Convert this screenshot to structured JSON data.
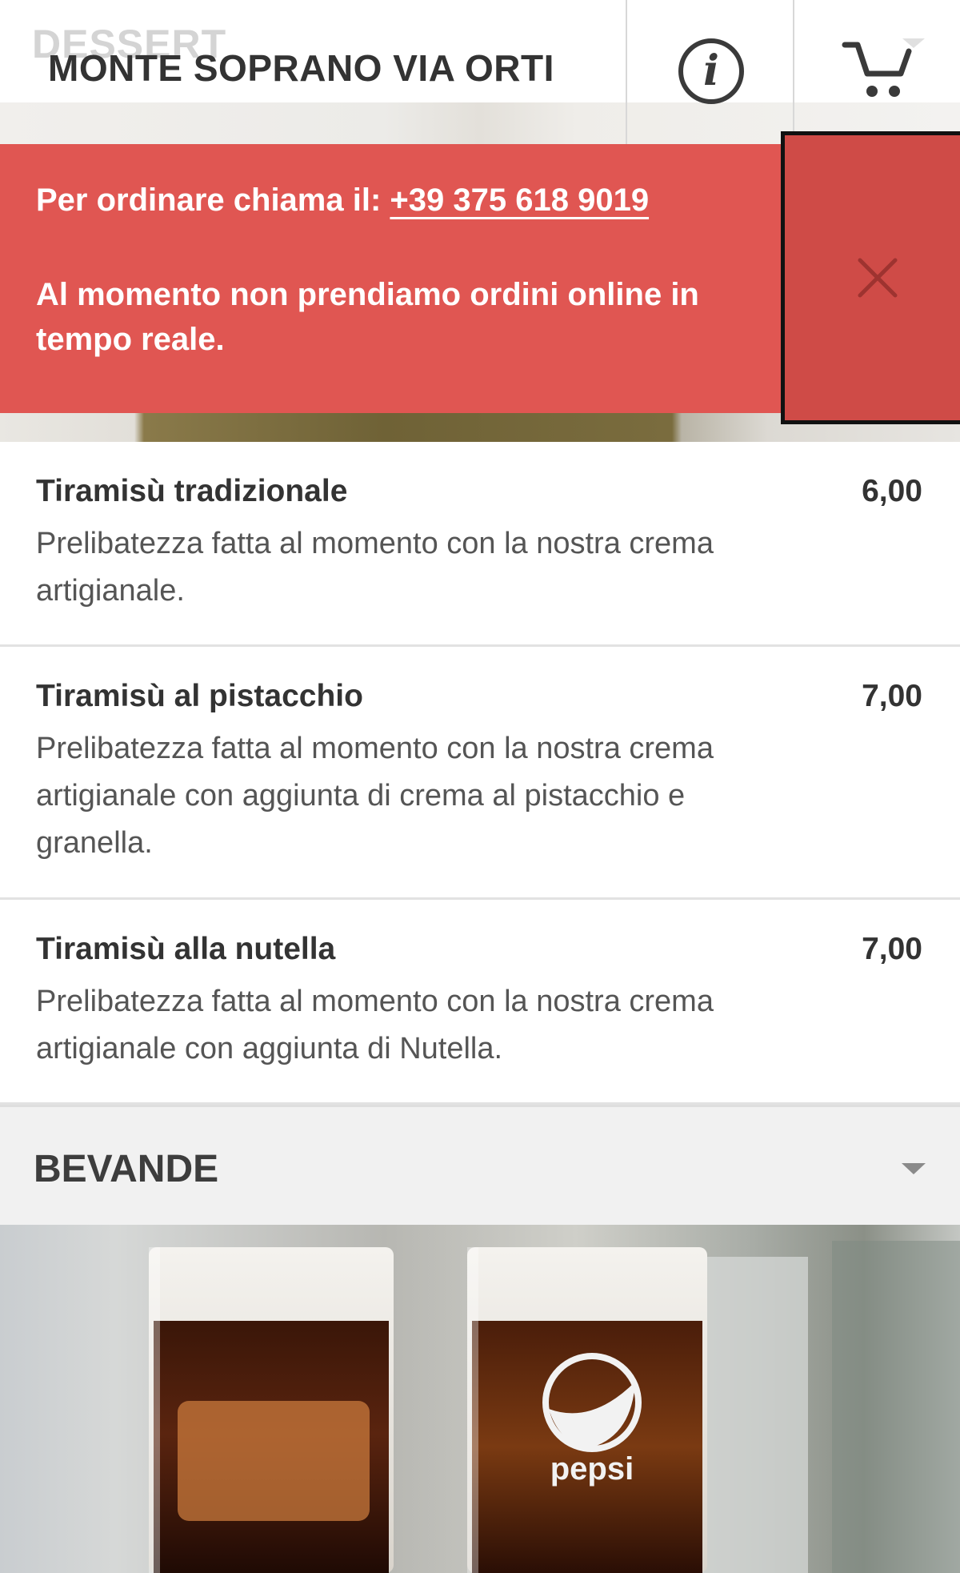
{
  "header": {
    "background_section_label": "DESSERT",
    "restaurant_name": "MONTE SOPRANO VIA ORTI",
    "info_icon": "info-icon",
    "cart_icon": "cart-icon"
  },
  "alert": {
    "order_prompt": "Per ordinare chiama il:",
    "phone": "+39 375 618 9019",
    "message": "Al momento non prendiamo ordini online in tempo reale.",
    "close_icon": "close-icon",
    "background_color": "#e05652"
  },
  "menu_items": [
    {
      "name": "Tiramisù tradizionale",
      "price": "6,00",
      "description": "Prelibatezza fatta al momento con la nostra crema artigianale."
    },
    {
      "name": "Tiramisù al pistacchio",
      "price": "7,00",
      "description": "Prelibatezza fatta al momento con la nostra crema artigianale con aggiunta di crema al pistacchio e granella."
    },
    {
      "name": "Tiramisù alla nutella",
      "price": "7,00",
      "description": "Prelibatezza fatta al momento con la nostra crema artigianale con aggiunta di Nutella."
    }
  ],
  "category": {
    "title": "BEVANDE",
    "chevron_icon": "chevron-down-icon"
  },
  "drinks_photo": {
    "logo_text": "pepsi"
  }
}
